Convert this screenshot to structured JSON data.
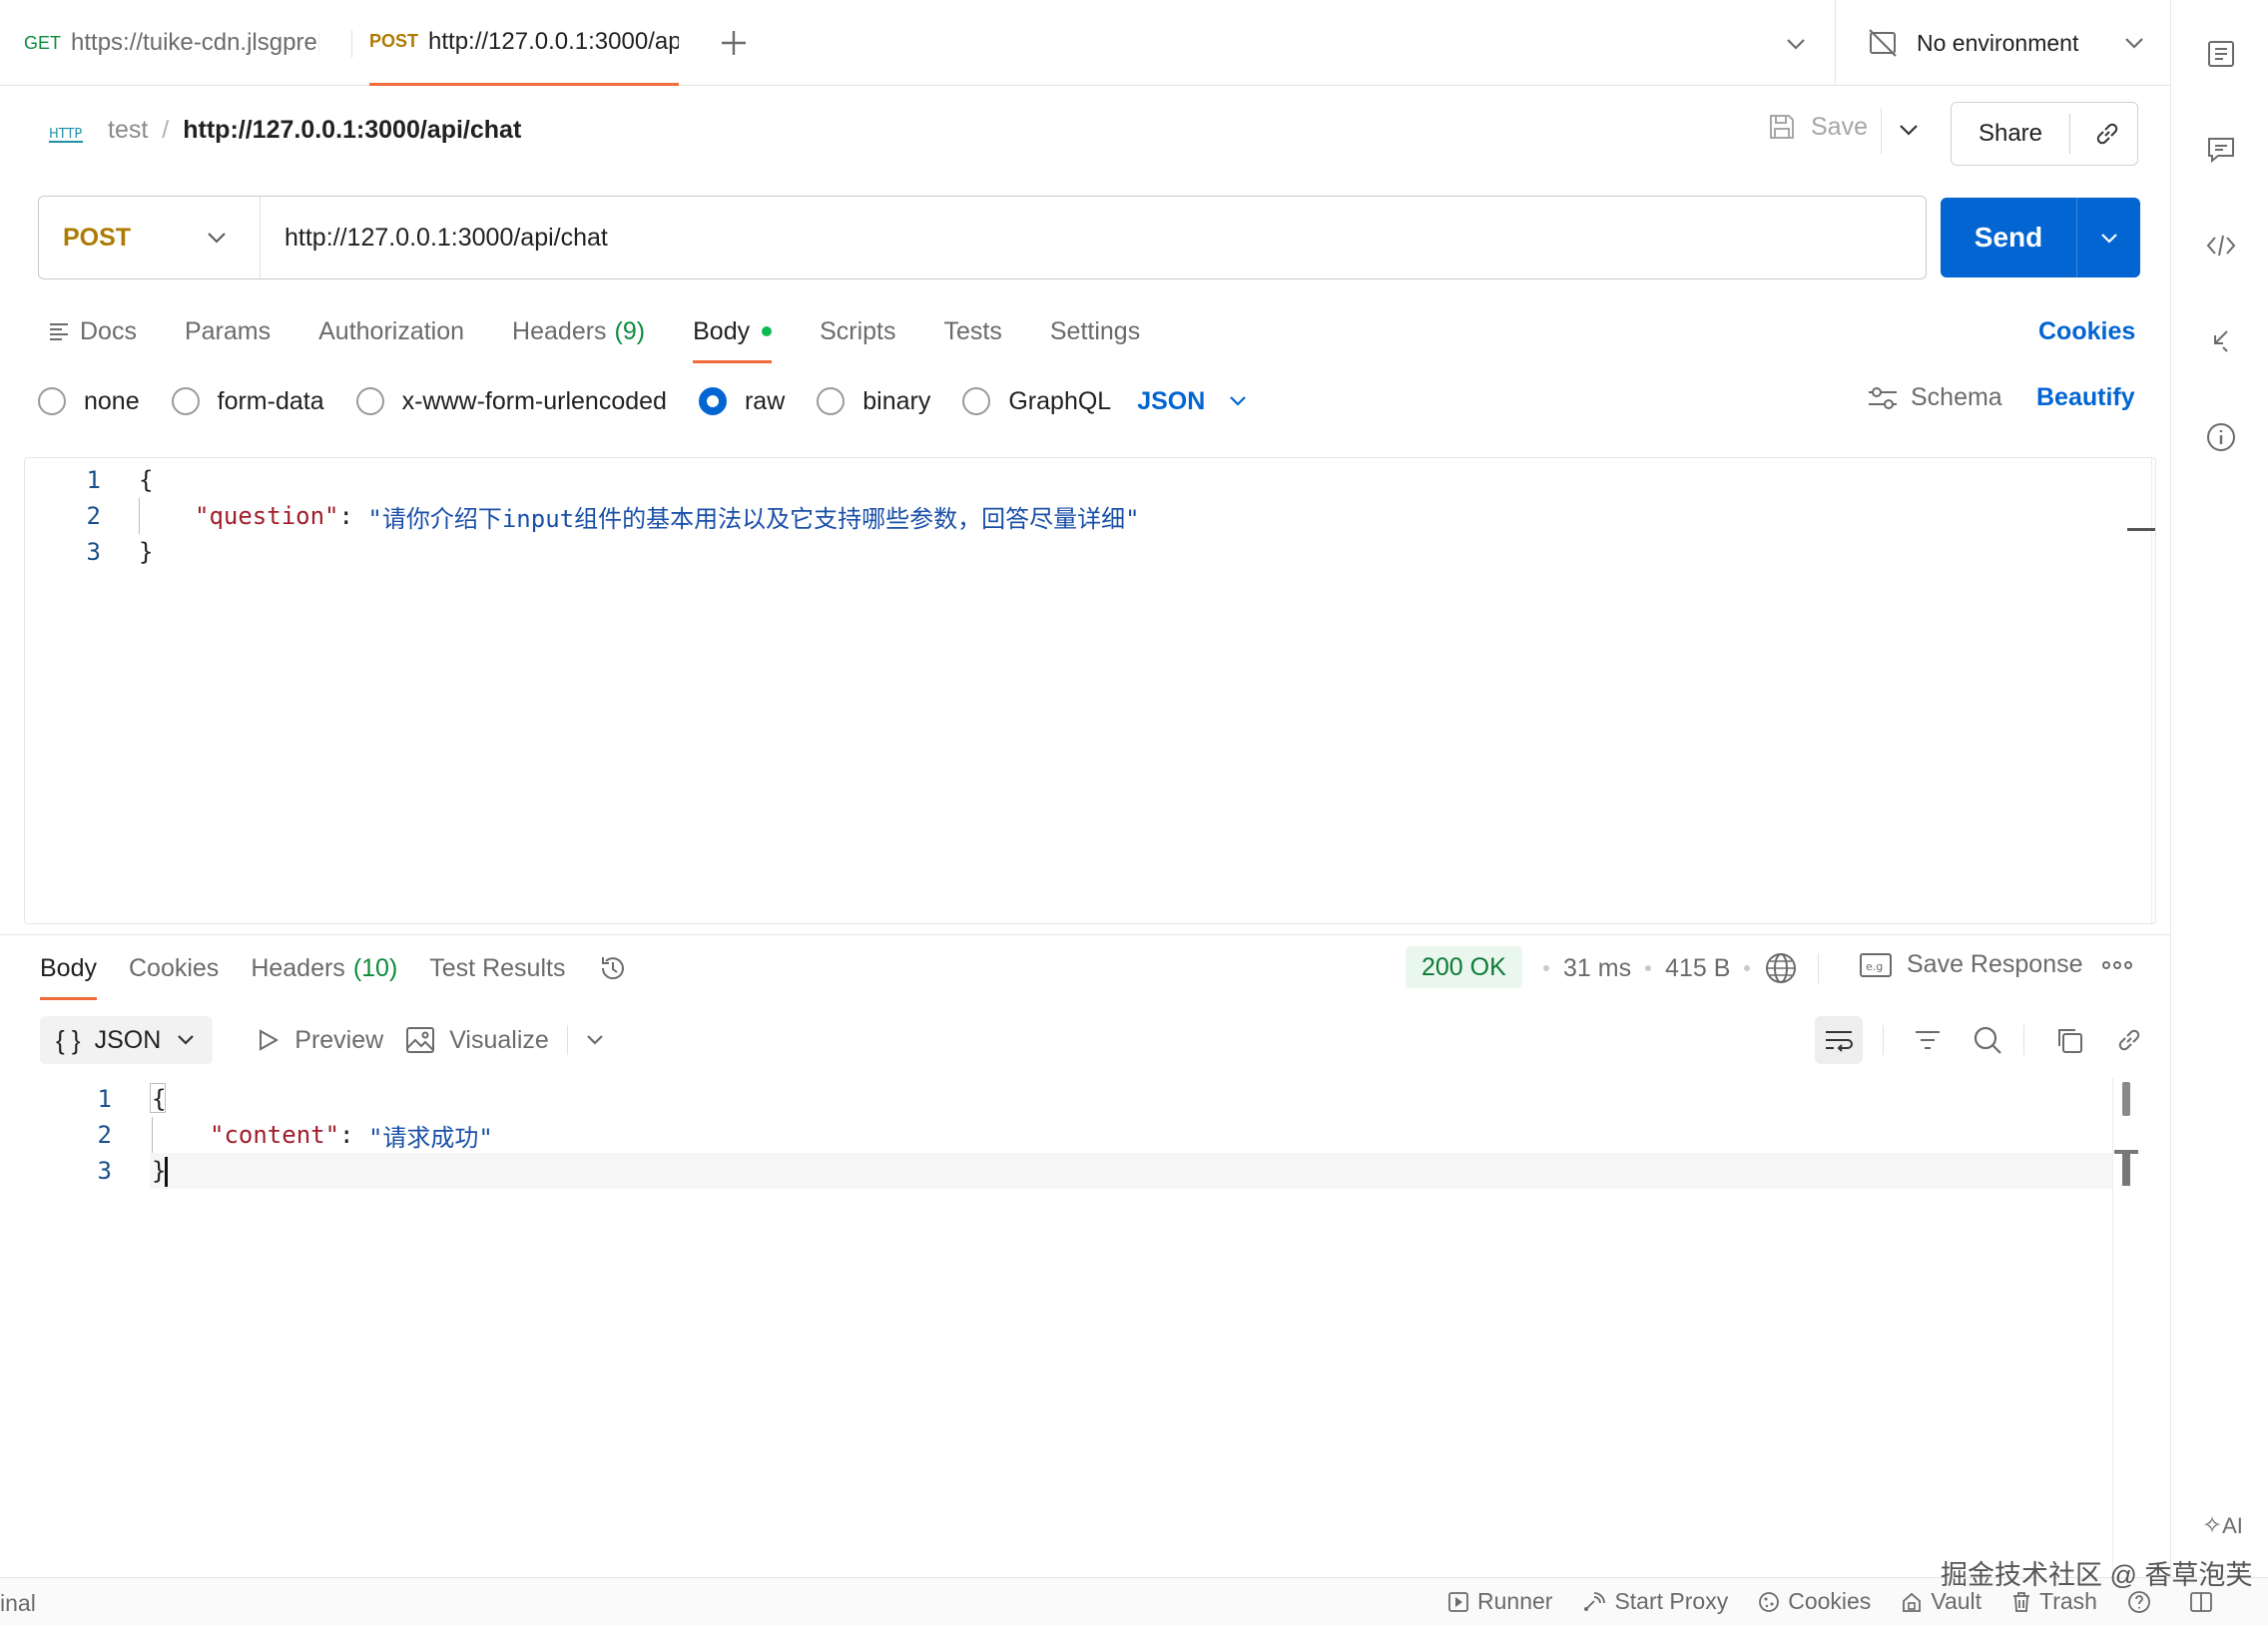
{
  "tabs": [
    {
      "method": "GET",
      "url": "https://tuike-cdn.jlsgpre|"
    },
    {
      "method": "POST",
      "url": "http://127.0.0.1:3000/ap"
    }
  ],
  "environment": {
    "label": "No environment"
  },
  "request": {
    "breadcrumb_parent": "test",
    "breadcrumb_sep": "/",
    "title": "http://127.0.0.1:3000/api/chat",
    "save_label": "Save",
    "share_label": "Share",
    "method": "POST",
    "url": "http://127.0.0.1:3000/api/chat",
    "send_label": "Send",
    "tabs": {
      "docs": "Docs",
      "params": "Params",
      "authorization": "Authorization",
      "headers": "Headers",
      "headers_count": "(9)",
      "body": "Body",
      "scripts": "Scripts",
      "tests": "Tests",
      "settings": "Settings"
    },
    "cookies_label": "Cookies",
    "body_types": [
      "none",
      "form-data",
      "x-www-form-urlencoded",
      "raw",
      "binary",
      "GraphQL"
    ],
    "selected_body_type": "raw",
    "format": "JSON",
    "schema_label": "Schema",
    "beautify_label": "Beautify",
    "body_lines": {
      "n1": "1",
      "n2": "2",
      "n3": "3",
      "open": "{",
      "key": "\"question\"",
      "colon": ": ",
      "value": "\"请你介绍下input组件的基本用法以及它支持哪些参数，回答尽量详细\"",
      "close": "}"
    }
  },
  "response": {
    "tabs": {
      "body": "Body",
      "cookies": "Cookies",
      "headers": "Headers",
      "headers_count": "(10)",
      "test_results": "Test Results"
    },
    "status": "200 OK",
    "time": "31 ms",
    "size": "415 B",
    "save_response_label": "Save Response",
    "format": "JSON",
    "preview_label": "Preview",
    "visualize_label": "Visualize",
    "body_lines": {
      "n1": "1",
      "n2": "2",
      "n3": "3",
      "open": "{",
      "key": "\"content\"",
      "colon": ": ",
      "value": "\"请求成功\"",
      "close": "}"
    }
  },
  "statusbar": {
    "left_text": "inal",
    "runner": "Runner",
    "start_proxy": "Start Proxy",
    "cookies": "Cookies",
    "vault": "Vault",
    "trash": "Trash"
  },
  "watermark": "掘金技术社区 @ 香草泡芙",
  "colors": {
    "accent_blue": "#0265d2",
    "post_method": "#ad7a03",
    "get_method": "#0c8a3e",
    "active_tab_underline": "#f26b3a",
    "status_ok": "#0c7a36"
  },
  "icons": [
    "plus-icon",
    "no-environment-icon",
    "http-icon",
    "save-icon",
    "link-icon",
    "chevron-down-icon",
    "docs-icon",
    "schema-icon",
    "history-icon",
    "globe-icon",
    "save-response-icon",
    "more-icon",
    "preview-icon",
    "visualize-icon",
    "wrap-icon",
    "filter-icon",
    "search-icon",
    "copy-icon",
    "runner-icon",
    "proxy-icon",
    "cookies-icon",
    "vault-icon",
    "trash-icon",
    "help-icon",
    "layout-icon",
    "ai-icon"
  ]
}
